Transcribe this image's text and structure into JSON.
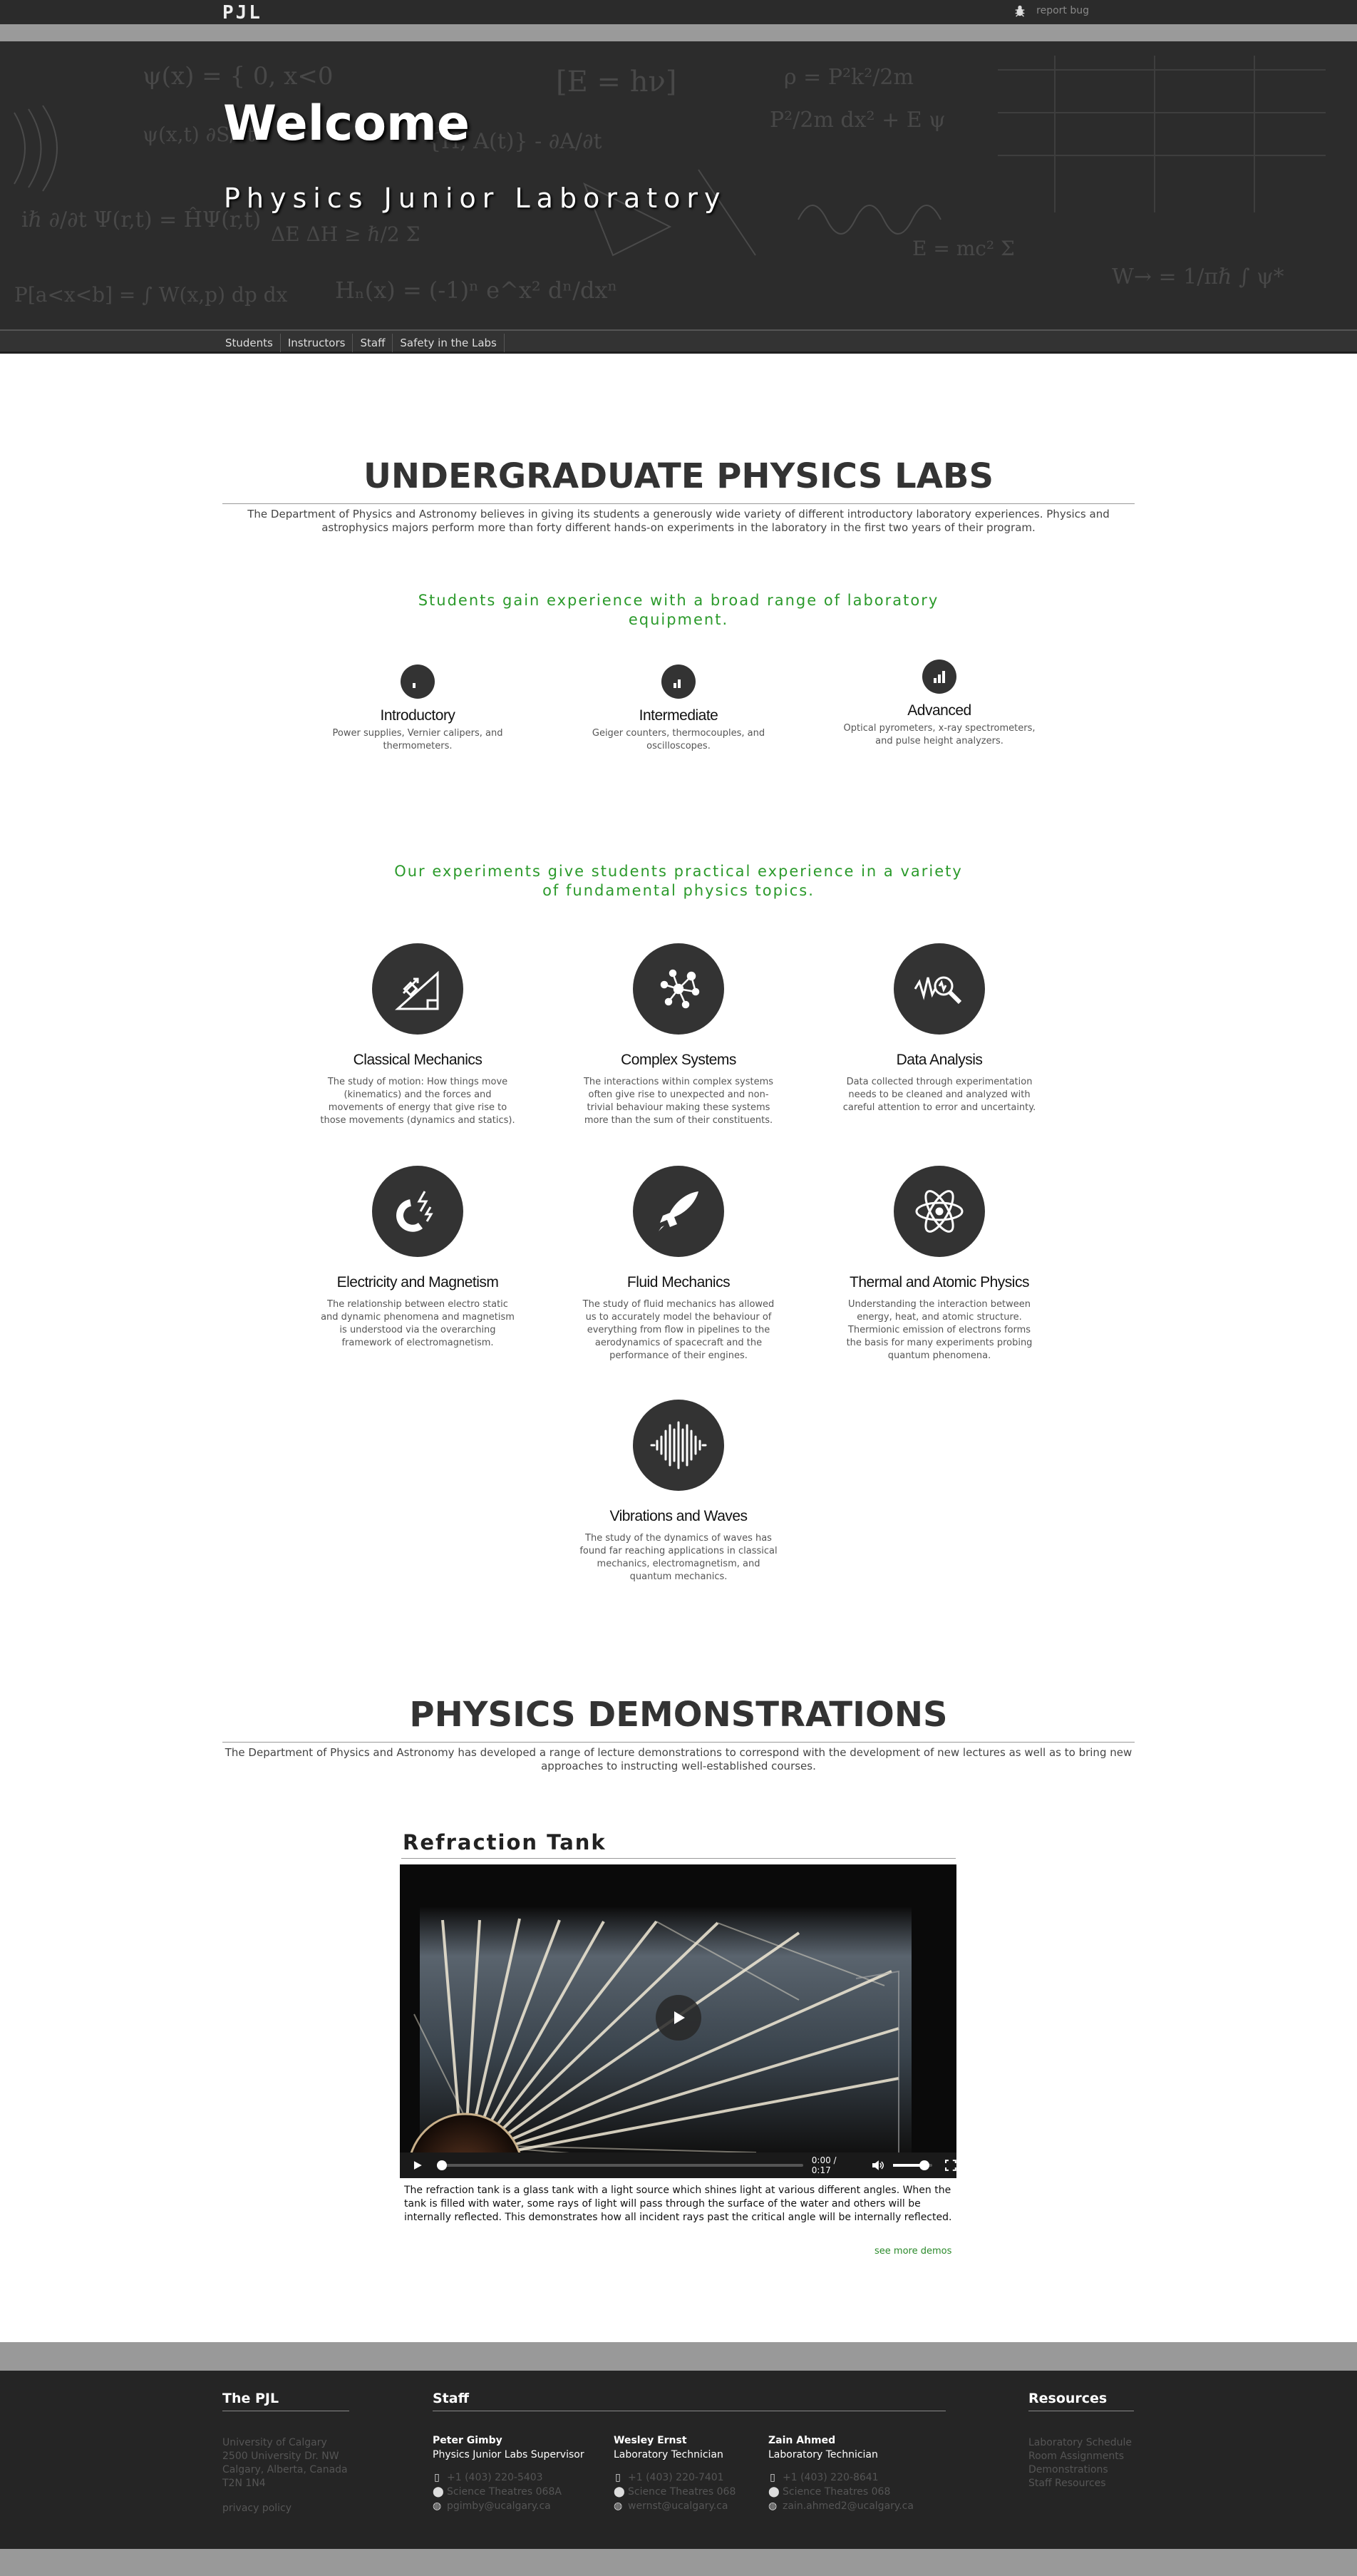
{
  "header": {
    "logo": "PJL",
    "report_bug": "report bug"
  },
  "hero": {
    "title": "Welcome",
    "subtitle": "Physics Junior Laboratory"
  },
  "nav": [
    "Students",
    "Instructors",
    "Staff",
    "Safety in the Labs"
  ],
  "labs": {
    "title": "UNDERGRADUATE PHYSICS LABS",
    "lead": "The Department of Physics and Astronomy believes in giving its students a generously wide variety of different introductory laboratory experiences. Physics and astrophysics majors perform more than forty different hands-on experiments in the laboratory in the first two years of their program.",
    "equipment_tagline": "Students gain experience with a broad range of laboratory equipment.",
    "levels": [
      {
        "name": "Introductory",
        "text": "Power supplies, Vernier calipers, and thermometers."
      },
      {
        "name": "Intermediate",
        "text": "Geiger counters, thermocouples, and oscilloscopes."
      },
      {
        "name": "Advanced",
        "text": "Optical pyrometers, x-ray spectrometers, and pulse height analyzers."
      }
    ],
    "topics_tagline": "Our experiments give students practical experience in a variety of fundamental physics topics.",
    "topics": [
      {
        "name": "Classical Mechanics",
        "text": "The study of motion: How things move (kinematics) and the forces and movements of energy that give rise to those movements (dynamics and statics)."
      },
      {
        "name": "Complex Systems",
        "text": "The interactions within complex systems often give rise to unexpected and non-trivial behaviour making these systems more than the sum of their constituents."
      },
      {
        "name": "Data Analysis",
        "text": "Data collected through experimentation needs to be cleaned and analyzed with careful attention to error and uncertainty."
      },
      {
        "name": "Electricity and Magnetism",
        "text": "The relationship between electro static and dynamic phenomena and magnetism is understood via the overarching framework of electromagnetism."
      },
      {
        "name": "Fluid Mechanics",
        "text": "The study of fluid mechanics has allowed us to accurately model the behaviour of everything from flow in pipelines to the aerodynamics of spacecraft and the performance of their engines."
      },
      {
        "name": "Thermal and Atomic Physics",
        "text": "Understanding the interaction between energy, heat, and atomic structure. Thermionic emission of electrons forms the basis for many experiments probing quantum phenomena."
      },
      {
        "name": "Vibrations and Waves",
        "text": "The study of the dynamics of waves has found far reaching applications in classical mechanics, electromagnetism, and quantum mechanics."
      }
    ]
  },
  "demos": {
    "title": "PHYSICS DEMONSTRATIONS",
    "lead": "The Department of Physics and Astronomy has developed a range of lecture demonstrations to correspond with the development of new lectures as well as to bring new approaches to instructing well-established courses.",
    "demo_title": "Refraction Tank",
    "video_time": "0:00 / 0:17",
    "progress": 0,
    "volume": 0.8,
    "description": "The refraction tank is a glass tank with a light source which shines light at various different angles. When the tank is filled with water, some rays of light will pass through the surface of the water and others will be internally reflected. This demonstrates how all incident rays past the critical angle will be internally reflected.",
    "more_link": "see more demos"
  },
  "footer": {
    "pjl": {
      "title": "The PJL",
      "address": [
        "University of Calgary",
        "2500 University Dr. NW",
        "Calgary, Alberta, Canada",
        "T2N 1N4"
      ],
      "privacy": "privacy policy"
    },
    "staff_title": "Staff",
    "staff": [
      {
        "name": "Peter Gimby",
        "role": "Physics Junior Labs Supervisor",
        "phone": "+1 (403) 220-5403",
        "room": "Science Theatres 068A",
        "email": "pgimby@ucalgary.ca"
      },
      {
        "name": "Wesley Ernst",
        "role": "Laboratory Technician",
        "phone": "+1 (403) 220-7401",
        "room": "Science Theatres 068",
        "email": "wernst@ucalgary.ca"
      },
      {
        "name": "Zain Ahmed",
        "role": "Laboratory Technician",
        "phone": "+1 (403) 220-8641",
        "room": "Science Theatres 068",
        "email": "zain.ahmed2@ucalgary.ca"
      }
    ],
    "resources": {
      "title": "Resources",
      "links": [
        "Laboratory Schedule",
        "Room Assignments",
        "Demonstrations",
        "Staff Resources"
      ]
    }
  }
}
